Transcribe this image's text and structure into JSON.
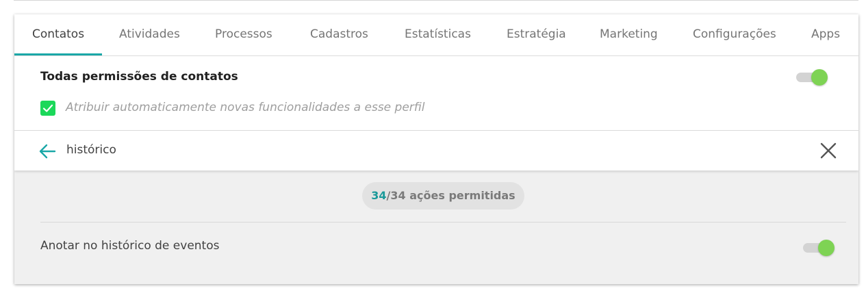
{
  "tabs": [
    {
      "label": "Contatos",
      "active": true
    },
    {
      "label": "Atividades",
      "active": false
    },
    {
      "label": "Processos",
      "active": false
    },
    {
      "label": "Cadastros",
      "active": false
    },
    {
      "label": "Estatísticas",
      "active": false
    },
    {
      "label": "Estratégia",
      "active": false
    },
    {
      "label": "Marketing",
      "active": false
    },
    {
      "label": "Configurações",
      "active": false
    },
    {
      "label": "Apps",
      "active": false
    }
  ],
  "all_permissions": {
    "title": "Todas permissões de contatos",
    "toggle_on": true,
    "auto_assign": {
      "checked": true,
      "label": "Atribuir automaticamente novas funcionalidades a esse perfil"
    }
  },
  "search": {
    "back_icon": "arrow-left-icon",
    "value": "histórico",
    "close_icon": "close-icon"
  },
  "results": {
    "allowed": "34",
    "summary": "/34 ações permitidas",
    "items": [
      {
        "label": "Anotar no histórico de eventos",
        "toggle_on": true
      }
    ]
  },
  "colors": {
    "accent": "#1aa7a7",
    "toggle_on": "#7ed354",
    "checkbox": "#1bd85a"
  }
}
